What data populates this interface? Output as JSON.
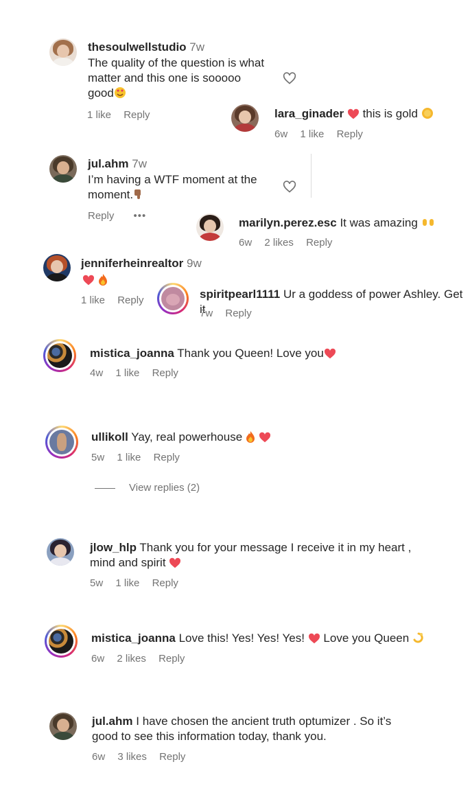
{
  "comments": [
    {
      "username": "thesoulwellstudio",
      "time": "7w",
      "text_line1": "The quality of the question is what",
      "text_line2": "matter and this one is sooooo",
      "text_line3": "good",
      "likes": "1 like",
      "reply": "Reply"
    },
    {
      "username": "lara_ginader",
      "text": "this is gold",
      "time": "6w",
      "likes": "1 like",
      "reply": "Reply"
    },
    {
      "username": "jul.ahm",
      "time": "7w",
      "text_line1": "I’m having a WTF moment at the",
      "text_line2": "moment.",
      "reply": "Reply",
      "more": "•••"
    },
    {
      "username": "marilyn.perez.esc",
      "text": "It was amazing",
      "time": "6w",
      "likes": "2 likes",
      "reply": "Reply"
    },
    {
      "username": "jenniferheinrealtor",
      "time": "9w",
      "likes": "1 like",
      "reply": "Reply"
    },
    {
      "username": "spiritpearl1111",
      "text": "Ur a goddess of power Ashley. Get it",
      "time": "7w",
      "reply": "Reply"
    },
    {
      "username": "mistica_joanna",
      "text": "Thank you Queen! Love you",
      "time": "4w",
      "likes": "1 like",
      "reply": "Reply"
    },
    {
      "username": "ullikoll",
      "text": "Yay, real powerhouse",
      "time": "5w",
      "likes": "1 like",
      "reply": "Reply",
      "view_replies": "View replies (2)"
    },
    {
      "username": "jlow_hlp",
      "text_line1": "Thank you for your message I receive it in my heart ,",
      "text_line2": "mind and spirit",
      "time": "5w",
      "likes": "1 like",
      "reply": "Reply"
    },
    {
      "username": "mistica_joanna",
      "text_part1": "Love this! Yes! Yes! Yes!",
      "text_part2": "Love you Queen",
      "time": "6w",
      "likes": "2 likes",
      "reply": "Reply"
    },
    {
      "username": "jul.ahm",
      "text_line1": "I have chosen the ancient truth optumizer . So it’s",
      "text_line2": "good to see this information today, thank you.",
      "time": "6w",
      "likes": "3 likes",
      "reply": "Reply"
    }
  ],
  "icons": {
    "heart_red": "red-heart-icon",
    "heart_outline": "heart-outline-icon",
    "fire": "fire-icon",
    "smile_hearts": "smiling-face-with-heart-eyes-icon",
    "gold_coin": "gold-coin-icon",
    "thumbs_down": "thumbs-down-icon",
    "raised_hands": "raised-hands-icon",
    "dizzy": "dizzy-icon"
  },
  "colors": {
    "text": "#262626",
    "meta": "#737373",
    "heart": "#ed4956"
  }
}
